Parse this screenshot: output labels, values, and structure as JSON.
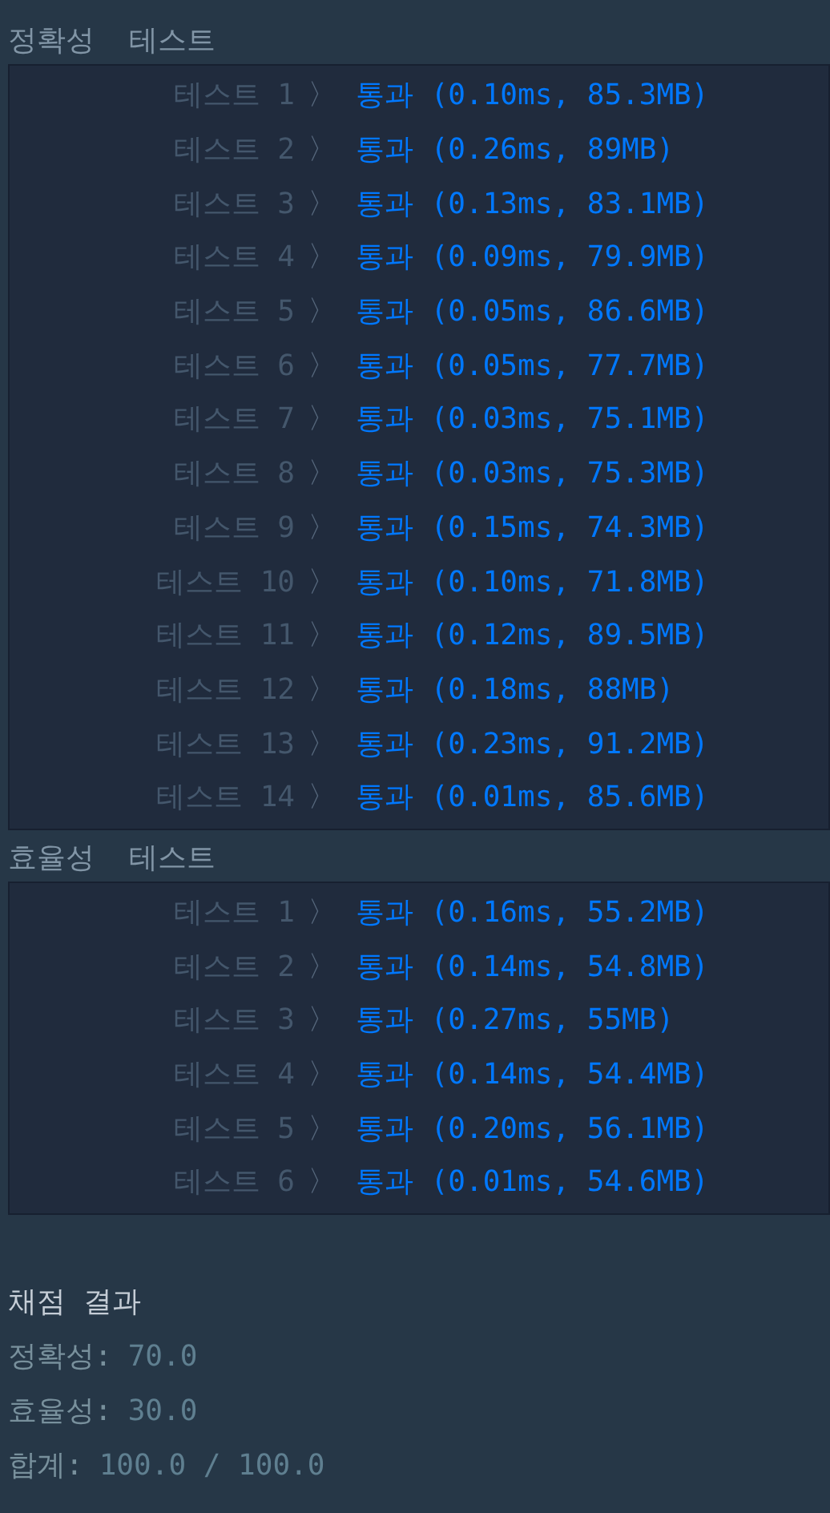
{
  "sections": [
    {
      "title": "정확성  테스트",
      "tests": [
        {
          "label": "테스트 1",
          "arrow": "〉",
          "result": "통과 (0.10ms, 85.3MB)"
        },
        {
          "label": "테스트 2",
          "arrow": "〉",
          "result": "통과 (0.26ms, 89MB)"
        },
        {
          "label": "테스트 3",
          "arrow": "〉",
          "result": "통과 (0.13ms, 83.1MB)"
        },
        {
          "label": "테스트 4",
          "arrow": "〉",
          "result": "통과 (0.09ms, 79.9MB)"
        },
        {
          "label": "테스트 5",
          "arrow": "〉",
          "result": "통과 (0.05ms, 86.6MB)"
        },
        {
          "label": "테스트 6",
          "arrow": "〉",
          "result": "통과 (0.05ms, 77.7MB)"
        },
        {
          "label": "테스트 7",
          "arrow": "〉",
          "result": "통과 (0.03ms, 75.1MB)"
        },
        {
          "label": "테스트 8",
          "arrow": "〉",
          "result": "통과 (0.03ms, 75.3MB)"
        },
        {
          "label": "테스트 9",
          "arrow": "〉",
          "result": "통과 (0.15ms, 74.3MB)"
        },
        {
          "label": "테스트 10",
          "arrow": "〉",
          "result": "통과 (0.10ms, 71.8MB)"
        },
        {
          "label": "테스트 11",
          "arrow": "〉",
          "result": "통과 (0.12ms, 89.5MB)"
        },
        {
          "label": "테스트 12",
          "arrow": "〉",
          "result": "통과 (0.18ms, 88MB)"
        },
        {
          "label": "테스트 13",
          "arrow": "〉",
          "result": "통과 (0.23ms, 91.2MB)"
        },
        {
          "label": "테스트 14",
          "arrow": "〉",
          "result": "통과 (0.01ms, 85.6MB)"
        }
      ]
    },
    {
      "title": "효율성  테스트",
      "tests": [
        {
          "label": "테스트 1",
          "arrow": "〉",
          "result": "통과 (0.16ms, 55.2MB)"
        },
        {
          "label": "테스트 2",
          "arrow": "〉",
          "result": "통과 (0.14ms, 54.8MB)"
        },
        {
          "label": "테스트 3",
          "arrow": "〉",
          "result": "통과 (0.27ms, 55MB)"
        },
        {
          "label": "테스트 4",
          "arrow": "〉",
          "result": "통과 (0.14ms, 54.4MB)"
        },
        {
          "label": "테스트 5",
          "arrow": "〉",
          "result": "통과 (0.20ms, 56.1MB)"
        },
        {
          "label": "테스트 6",
          "arrow": "〉",
          "result": "통과 (0.01ms, 54.6MB)"
        }
      ]
    }
  ],
  "summary": {
    "title": "채점 결과",
    "lines": [
      {
        "label": "정확성:",
        "value": "70.0"
      },
      {
        "label": "효율성:",
        "value": "30.0"
      },
      {
        "label": "합계:",
        "value": "100.0 / 100.0"
      }
    ]
  }
}
